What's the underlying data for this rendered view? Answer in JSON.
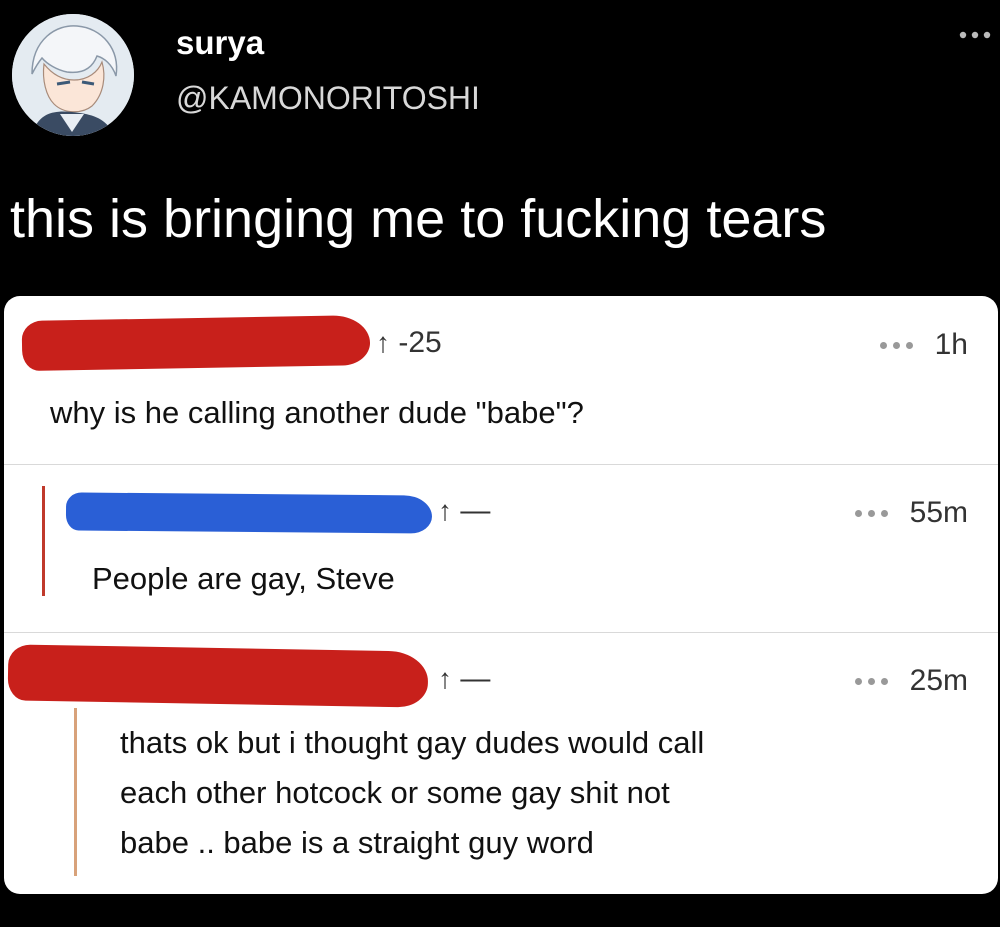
{
  "author": {
    "display_name": "surya",
    "handle": "@KAMONORITOSHI"
  },
  "tweet": {
    "text": "this is bringing me to fucking tears"
  },
  "comments": [
    {
      "vote_arrow": "↑",
      "vote_count": "-25",
      "time": "1h",
      "text": "why is he calling another dude \"babe\"?",
      "redaction_color": "#c8201b"
    },
    {
      "vote_arrow": "↑",
      "vote_count": "—",
      "time": "55m",
      "text": "People are gay, Steve",
      "redaction_color": "#2a5fd6",
      "thread_line_color": "#c0392b"
    },
    {
      "vote_arrow": "↑",
      "vote_count": "—",
      "time": "25m",
      "text_lines": [
        "thats ok but i thought gay dudes would call",
        "each other hotcock or some gay shit not",
        "babe .. babe is a straight guy word"
      ],
      "redaction_color": "#c8201b",
      "thread_line_color": "#d8a27a"
    }
  ],
  "icons": {
    "more": "more-horizontal-icon",
    "comment_more": "ellipsis-icon",
    "upvote": "upvote-arrow-icon"
  }
}
